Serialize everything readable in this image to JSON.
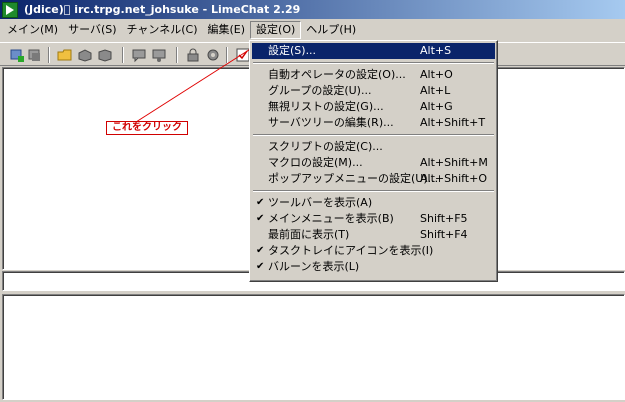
{
  "window": {
    "title": "(Jdice)\u0000 irc.trpg.net_johsuke - LimeChat 2.29"
  },
  "menubar": [
    {
      "label": "メイン(M)",
      "key": "main"
    },
    {
      "label": "サーバ(S)",
      "key": "server"
    },
    {
      "label": "チャンネル(C)",
      "key": "channel"
    },
    {
      "label": "編集(E)",
      "key": "edit"
    },
    {
      "label": "設定(O)",
      "key": "settings",
      "open": true
    },
    {
      "label": "ヘルプ(H)",
      "key": "help"
    }
  ],
  "toolbar": {
    "icons": [
      "connect-icon",
      "disconnect-icon",
      "folder-icon",
      "server-icon",
      "channel-icon",
      "chat-icon",
      "user-icon",
      "lock-icon",
      "gear-icon",
      "checkbox-icon"
    ]
  },
  "settings_menu": {
    "groups": [
      [
        {
          "label": "設定(S)...",
          "shortcut": "Alt+S",
          "selected": true
        }
      ],
      [
        {
          "label": "自動オペレータの設定(O)...",
          "shortcut": "Alt+O"
        },
        {
          "label": "グループの設定(U)...",
          "shortcut": "Alt+L"
        },
        {
          "label": "無視リストの設定(G)...",
          "shortcut": "Alt+G"
        },
        {
          "label": "サーバツリーの編集(R)...",
          "shortcut": "Alt+Shift+T"
        }
      ],
      [
        {
          "label": "スクリプトの設定(C)...",
          "shortcut": ""
        },
        {
          "label": "マクロの設定(M)...",
          "shortcut": "Alt+Shift+M"
        },
        {
          "label": "ポップアップメニューの設定(U)...",
          "shortcut": "Alt+Shift+O"
        }
      ],
      [
        {
          "label": "ツールバーを表示(A)",
          "shortcut": "",
          "checked": true
        },
        {
          "label": "メインメニューを表示(B)",
          "shortcut": "Shift+F5",
          "checked": true
        },
        {
          "label": "最前面に表示(T)",
          "shortcut": "Shift+F4",
          "checked": false
        },
        {
          "label": "タスクトレイにアイコンを表示(I)",
          "shortcut": "",
          "checked": true
        },
        {
          "label": "バルーンを表示(L)",
          "shortcut": "",
          "checked": true
        }
      ]
    ]
  },
  "annotation": {
    "text": "これをクリック",
    "color": "#d00000"
  }
}
